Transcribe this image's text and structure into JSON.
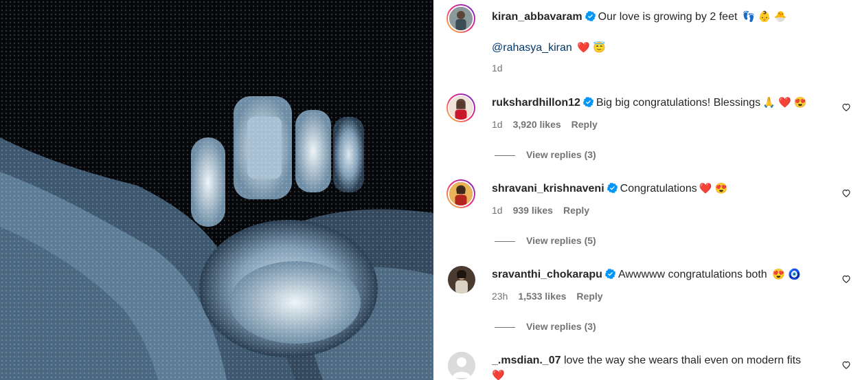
{
  "post": {
    "username": "kiran_abbavaram",
    "caption": "Our love is growing by 2 feet",
    "caption_emojis": "👣 👶 🐣",
    "mention": "@rahasya_kiran",
    "mention_emojis": "❤️ 😇",
    "time": "1d"
  },
  "comments": [
    {
      "username": "rukshardhillon12",
      "verified": true,
      "text": "Big big congratulations! Blessings",
      "emojis": "🙏 ❤️ 😍",
      "time": "1d",
      "likes": "3,920 likes",
      "reply_label": "Reply",
      "view_replies": "View replies (3)"
    },
    {
      "username": "shravani_krishnaveni",
      "verified": true,
      "text": "Congratulations",
      "emojis": "❤️ 😍",
      "time": "1d",
      "likes": "939 likes",
      "reply_label": "Reply",
      "view_replies": "View replies (5)"
    },
    {
      "username": "sravanthi_chokarapu",
      "verified": true,
      "text": "Awwwww congratulations both",
      "emojis": "😍 🧿",
      "time": "23h",
      "likes": "1,533 likes",
      "reply_label": "Reply",
      "view_replies": "View replies (3)"
    },
    {
      "username": "_.msdian._07",
      "verified": false,
      "text": "love the way she wears thali even on modern fits",
      "emojis": "❤️"
    }
  ],
  "icons": {
    "verified": "verified-badge-icon",
    "like": "heart-outline-icon"
  },
  "colors": {
    "verified": "#0095f6",
    "mention": "#00376b",
    "secondary_text": "#737373"
  }
}
